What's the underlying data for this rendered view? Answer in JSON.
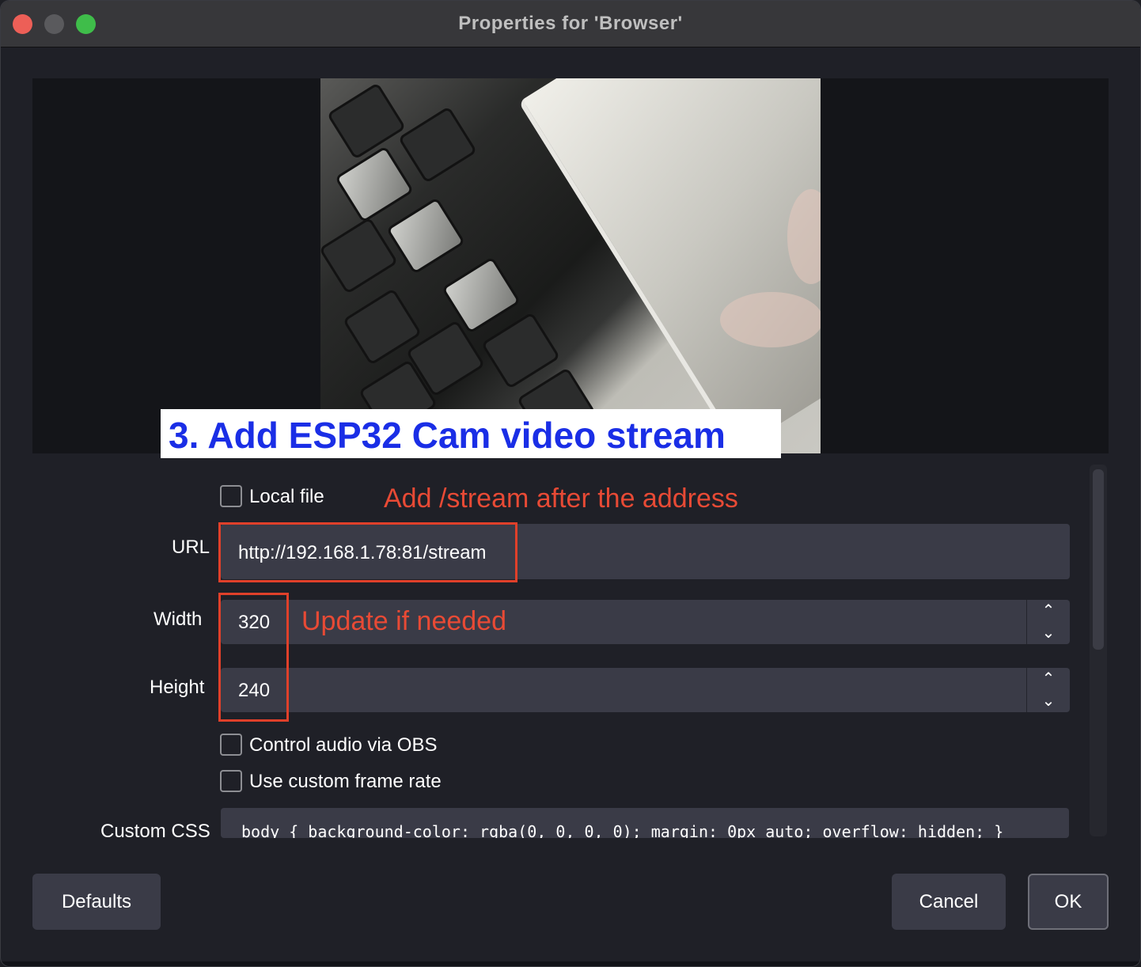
{
  "window": {
    "title": "Properties for 'Browser'"
  },
  "banner": {
    "text": "3. Add ESP32 Cam video stream"
  },
  "form": {
    "local_file_label": "Local file",
    "url_label": "URL",
    "url_value": "http://192.168.1.78:81/stream",
    "width_label": "Width",
    "width_value": "320",
    "height_label": "Height",
    "height_value": "240",
    "control_audio_label": "Control audio via OBS",
    "custom_frame_rate_label": "Use custom frame rate",
    "custom_css_label": "Custom CSS",
    "custom_css_value": "body { background-color: rgba(0, 0, 0, 0); margin: 0px auto; overflow: hidden; }"
  },
  "annotations": {
    "url_note": "Add /stream after the address",
    "size_note": "Update if needed"
  },
  "buttons": {
    "defaults": "Defaults",
    "cancel": "Cancel",
    "ok": "OK"
  },
  "icons": {
    "close": "close-icon",
    "minimize": "minimize-icon",
    "maximize": "maximize-icon",
    "spin_up": "chevron-up-icon",
    "spin_down": "chevron-down-icon"
  },
  "colors": {
    "annotation_red": "#e84a35",
    "banner_blue": "#1a2ee6",
    "window_bg": "#1f2027",
    "field_bg": "#3a3b47"
  }
}
